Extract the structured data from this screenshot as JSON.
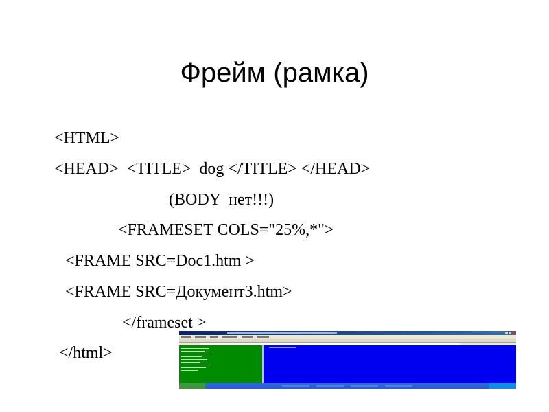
{
  "slide": {
    "title": "Фрейм (рамка)",
    "code_lines": [
      "<HTML>",
      "<HEAD>  <TITLE>  dog </TITLE> </HEAD>",
      "(BODY  нет!!!)",
      "<FRAMESET COLS=\"25%,*\">",
      "<FRAME SRC=Doc1.htm >",
      "<FRAME SRC=Документ3.htm>",
      "</frameset >",
      "</html>"
    ]
  },
  "screenshot": {
    "left_frame_color": "#008a00",
    "right_frame_color": "#0000f0"
  }
}
